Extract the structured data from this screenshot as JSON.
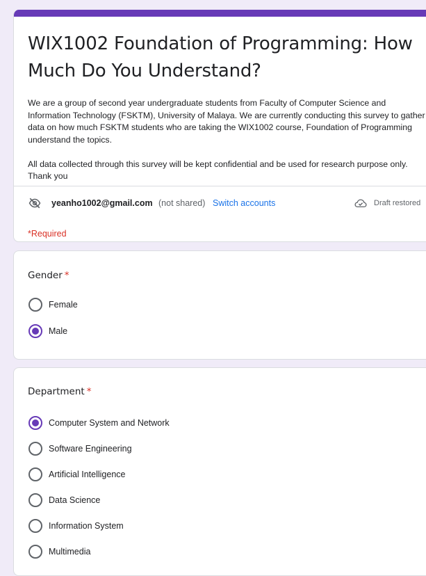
{
  "form": {
    "title": "WIX1002 Foundation of Programming: How Much Do You Understand?",
    "description": "We are a group of second year undergraduate students from Faculty of Computer Science and Information Technology (FSKTM), University of Malaya. We are currently conducting this survey to gather data on how much FSKTM students who are taking the WIX1002 course, Foundation of Programming understand the topics.\n\nAll data collected through this survey will be kept confidential and be used for research purpose only. Thank you",
    "accent_color": "#673ab7"
  },
  "account": {
    "email": "yeanho1002@gmail.com",
    "note": "(not shared)",
    "switch_label": "Switch accounts",
    "draft_status": "Draft restored"
  },
  "required_note": "*Required",
  "questions": [
    {
      "title": "Gender",
      "required_mark": "*",
      "options": [
        {
          "label": "Female",
          "selected": false
        },
        {
          "label": "Male",
          "selected": true
        }
      ]
    },
    {
      "title": "Department",
      "required_mark": "*",
      "options": [
        {
          "label": "Computer System and Network",
          "selected": true
        },
        {
          "label": "Software Engineering",
          "selected": false
        },
        {
          "label": "Artificial Intelligence",
          "selected": false
        },
        {
          "label": "Data Science",
          "selected": false
        },
        {
          "label": "Information System",
          "selected": false
        },
        {
          "label": "Multimedia",
          "selected": false
        }
      ]
    }
  ]
}
